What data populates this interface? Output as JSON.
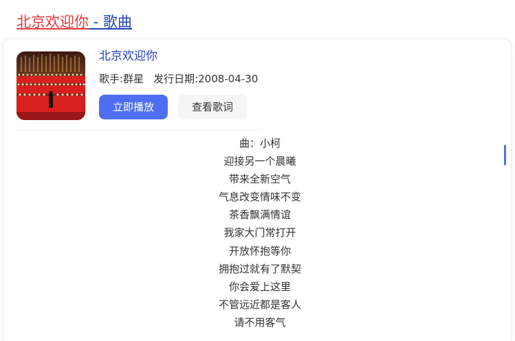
{
  "result": {
    "title_highlight": "北京欢迎你",
    "title_rest": " - 歌曲"
  },
  "song": {
    "title": "北京欢迎你",
    "singer_label": "歌手:",
    "singer": "群星",
    "release_label": "发行日期:",
    "release_date": "2008-04-30",
    "play_label": "立即播放",
    "lyrics_label": "查看歌词"
  },
  "lyrics": [
    "曲：小柯",
    "迎接另一个晨曦",
    "带来全新空气",
    "气息改变情味不变",
    "茶香飘满情谊",
    "我家大门常打开",
    "开放怀抱等你",
    "拥抱过就有了默契",
    "你会爱上这里",
    "不管远近都是客人",
    "请不用客气"
  ],
  "colors": {
    "accent": "#4e6ef2",
    "link": "#2440b3",
    "highlight": "#e4393c"
  }
}
